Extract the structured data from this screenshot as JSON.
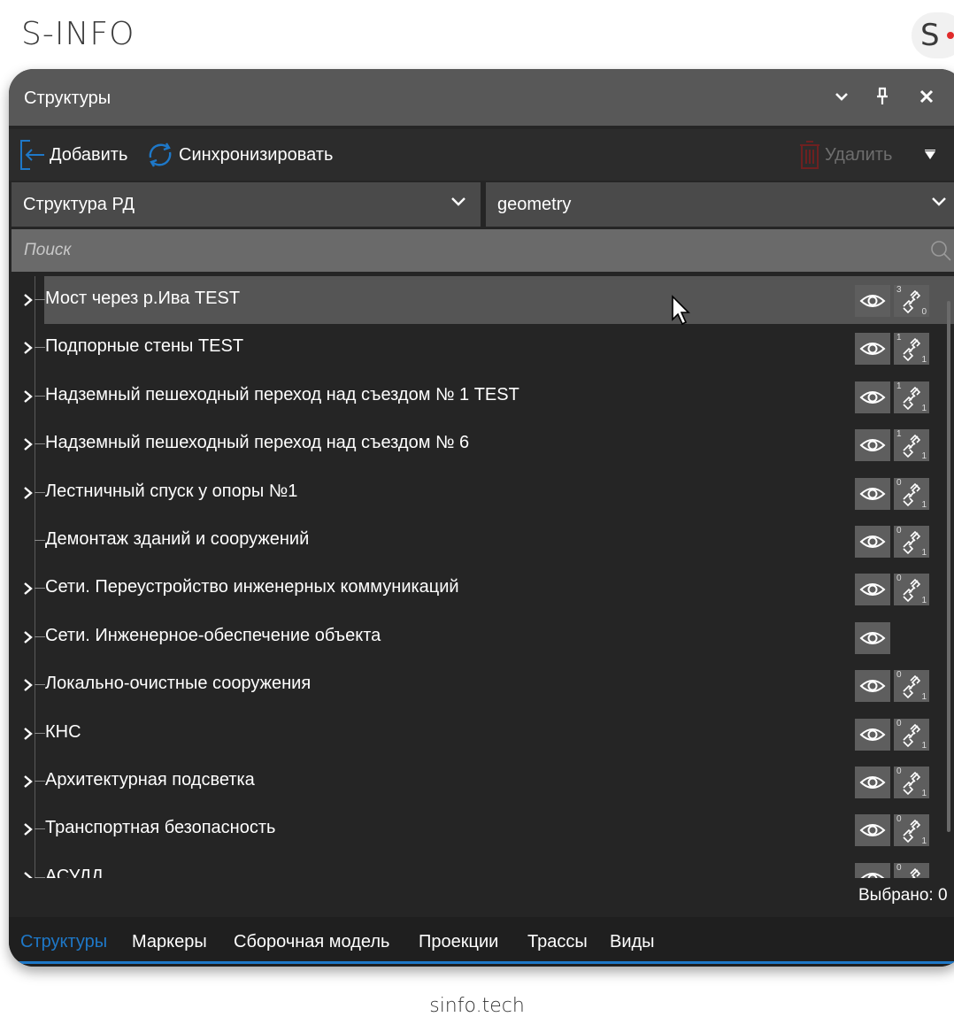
{
  "brand": {
    "name": "S-INFO",
    "logo_letter": "S"
  },
  "footer": {
    "site": "sinfo.tech"
  },
  "panel": {
    "title": "Структуры",
    "toolbar": {
      "add_label": "Добавить",
      "sync_label": "Синхронизировать",
      "delete_label": "Удалить"
    },
    "structure_select": {
      "value": "Структура РД"
    },
    "layer_select": {
      "value": "geometry"
    },
    "search": {
      "placeholder": "Поиск"
    },
    "tree_items": [
      {
        "label": "Мост через р.Ива TEST",
        "expandable": true,
        "highlighted": true,
        "link_top": "3",
        "link_bottom": "0",
        "has_link": true
      },
      {
        "label": "Подпорные стены TEST",
        "expandable": true,
        "link_top": "1",
        "link_bottom": "1",
        "has_link": true
      },
      {
        "label": "Надземный пешеходный переход над съездом № 1 TEST",
        "expandable": true,
        "link_top": "1",
        "link_bottom": "1",
        "has_link": true
      },
      {
        "label": "Надземный пешеходный переход над съездом № 6",
        "expandable": true,
        "link_top": "1",
        "link_bottom": "1",
        "has_link": true
      },
      {
        "label": "Лестничный спуск у опоры №1",
        "expandable": true,
        "link_top": "0",
        "link_bottom": "1",
        "has_link": true
      },
      {
        "label": "Демонтаж зданий и сооружений",
        "expandable": false,
        "link_top": "0",
        "link_bottom": "1",
        "has_link": true
      },
      {
        "label": "Сети. Переустройство инженерных коммуникаций",
        "expandable": true,
        "link_top": "0",
        "link_bottom": "1",
        "has_link": true
      },
      {
        "label": "Сети. Инженерное-обеспечение объекта",
        "expandable": true,
        "has_link": false
      },
      {
        "label": "Локально-очистные сооружения",
        "expandable": true,
        "link_top": "0",
        "link_bottom": "1",
        "has_link": true
      },
      {
        "label": "КНС",
        "expandable": true,
        "link_top": "0",
        "link_bottom": "1",
        "has_link": true
      },
      {
        "label": "Архитектурная подсветка",
        "expandable": true,
        "link_top": "0",
        "link_bottom": "1",
        "has_link": true
      },
      {
        "label": "Транспортная безопасность",
        "expandable": true,
        "link_top": "0",
        "link_bottom": "1",
        "has_link": true
      },
      {
        "label": "АСУДД",
        "expandable": true,
        "link_top": "0",
        "link_bottom": "",
        "has_link": true
      }
    ],
    "status": "Выбрано: 0",
    "tabs": [
      "Структуры",
      "Маркеры",
      "Сборочная модель",
      "Проекции",
      "Трассы",
      "Виды"
    ],
    "active_tab": "Структуры"
  },
  "colors": {
    "accent": "#1e78c8",
    "panel_bg": "#252525",
    "titlebar_bg": "#585858",
    "highlight_row": "#555555",
    "logo_dot": "#e02a2a"
  },
  "icons": [
    "chevron-down-icon",
    "pin-icon",
    "close-icon",
    "add-icon",
    "sync-icon",
    "trash-icon",
    "filter-icon",
    "search-icon",
    "eye-icon",
    "link-icon",
    "expand-arrow-icon",
    "mouse-cursor-icon"
  ]
}
